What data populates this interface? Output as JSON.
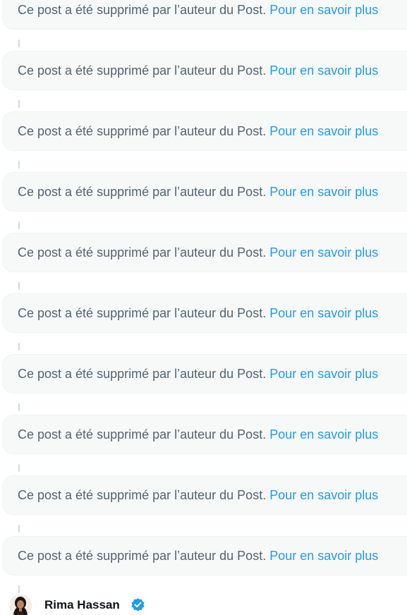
{
  "thread": {
    "deleted_posts": [
      {
        "text": "Ce post a été supprimé par l’auteur du Post.",
        "link": "Pour en savoir plus"
      },
      {
        "text": "Ce post a été supprimé par l’auteur du Post.",
        "link": "Pour en savoir plus"
      },
      {
        "text": "Ce post a été supprimé par l’auteur du Post.",
        "link": "Pour en savoir plus"
      },
      {
        "text": "Ce post a été supprimé par l’auteur du Post.",
        "link": "Pour en savoir plus"
      },
      {
        "text": "Ce post a été supprimé par l’auteur du Post.",
        "link": "Pour en savoir plus"
      },
      {
        "text": "Ce post a été supprimé par l’auteur du Post.",
        "link": "Pour en savoir plus"
      },
      {
        "text": "Ce post a été supprimé par l’auteur du Post.",
        "link": "Pour en savoir plus"
      },
      {
        "text": "Ce post a été supprimé par l’auteur du Post.",
        "link": "Pour en savoir plus"
      },
      {
        "text": "Ce post a été supprimé par l’auteur du Post.",
        "link": "Pour en savoir plus"
      },
      {
        "text": "Ce post a été supprimé par l’auteur du Post.",
        "link": "Pour en savoir plus"
      }
    ],
    "author": {
      "name": "Rima Hassan",
      "verified": true,
      "avatar_icon": "user-avatar",
      "badge_icon": "verified-badge-icon"
    }
  },
  "colors": {
    "card_bg": "#f7f9f9",
    "card_border": "#eff3f4",
    "text_secondary": "#536471",
    "link": "#1d9bf0",
    "connector": "#cfd9de",
    "name": "#0f1419"
  }
}
